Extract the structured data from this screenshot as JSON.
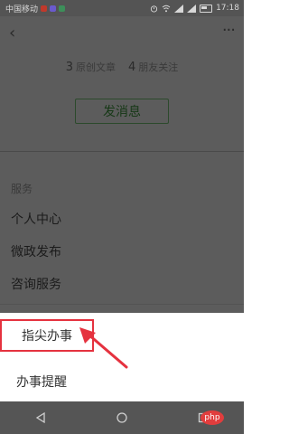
{
  "status_bar": {
    "carrier": "中国移动",
    "time": "17:18"
  },
  "topnav": {
    "back_icon": "‹",
    "more_icon": "···"
  },
  "stats": {
    "articles_count": "3",
    "articles_label": "原创文章",
    "followers_count": "4",
    "followers_label": "朋友关注"
  },
  "send_button": "发消息",
  "services": {
    "title": "服务",
    "items": [
      "个人中心",
      "微政发布",
      "咨询服务"
    ]
  },
  "bottom_sheet": {
    "items": [
      "指尖办事",
      "办事提醒"
    ]
  },
  "watermark": "php",
  "colors": {
    "overlay_bg": "#5c5c5c",
    "sheet_bg": "#ffffff",
    "highlight_red": "#e5323f"
  }
}
